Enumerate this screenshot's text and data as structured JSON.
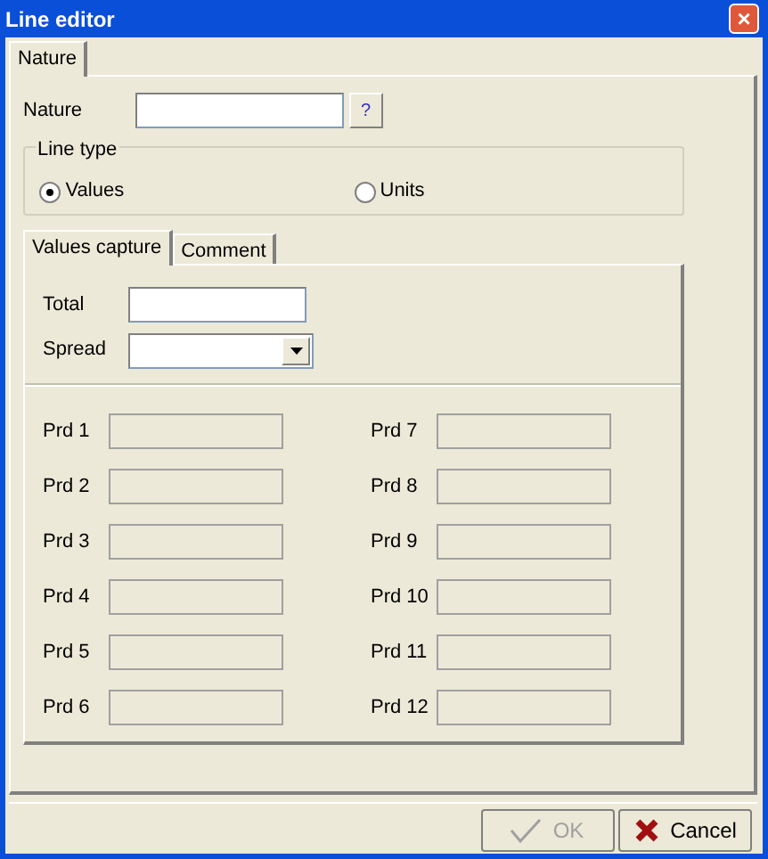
{
  "window": {
    "title": "Line editor",
    "close": "×"
  },
  "tabs": [
    {
      "label": "Nature",
      "selected": true
    }
  ],
  "nature": {
    "label": "Nature",
    "help": "?"
  },
  "line_type": {
    "legend": "Line type",
    "options": [
      {
        "label": "Values",
        "selected": true
      },
      {
        "label": "Units",
        "selected": false
      }
    ]
  },
  "sub_tabs": [
    {
      "label": "Values capture",
      "selected": true
    },
    {
      "label": "Comment",
      "selected": false
    }
  ],
  "total": {
    "label": "Total"
  },
  "spread": {
    "label": "Spread"
  },
  "periods": [
    {
      "label": "Prd 1",
      "disabled": true
    },
    {
      "label": "Prd 2",
      "disabled": true
    },
    {
      "label": "Prd 3",
      "disabled": true
    },
    {
      "label": "Prd 4",
      "disabled": true
    },
    {
      "label": "Prd 5",
      "disabled": true
    },
    {
      "label": "Prd 6",
      "disabled": true
    },
    {
      "label": "Prd 7",
      "disabled": true
    },
    {
      "label": "Prd 8",
      "disabled": true
    },
    {
      "label": "Prd 9",
      "disabled": true
    },
    {
      "label": "Prd 10",
      "disabled": true
    },
    {
      "label": "Prd 11",
      "disabled": true
    },
    {
      "label": "Prd 12",
      "disabled": true
    }
  ],
  "buttons": [
    {
      "kind": "ok",
      "label": "OK",
      "disabled": true
    },
    {
      "kind": "cancel",
      "label": "Cancel",
      "disabled": false
    }
  ]
}
